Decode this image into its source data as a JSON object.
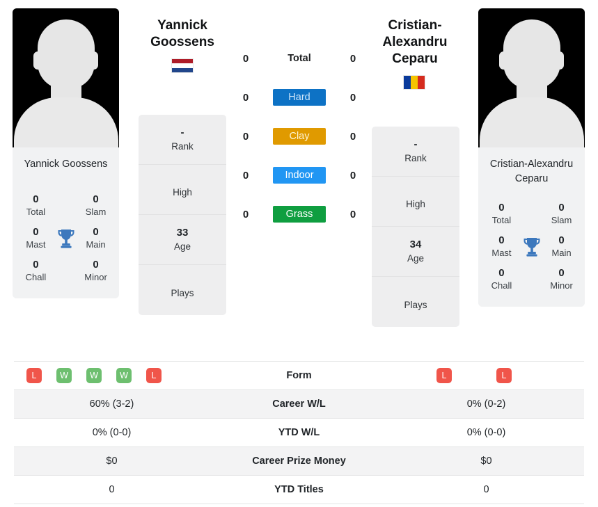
{
  "players": {
    "left": {
      "name": "Yannick Goossens",
      "photo_caption": "Yannick Goossens",
      "flag": "netherlands-flag",
      "avatar": "player-avatar-placeholder",
      "rank_card": [
        {
          "value": "-",
          "label": "Rank"
        },
        {
          "value": "",
          "label": "High"
        },
        {
          "value": "33",
          "label": "Age"
        },
        {
          "value": "",
          "label": "Plays"
        }
      ],
      "titles": {
        "total": "0",
        "slam": "0",
        "mast": "0",
        "main": "0",
        "chall": "0",
        "minor": "0"
      },
      "surface_counts": {
        "total": "0",
        "hard": "0",
        "clay": "0",
        "indoor": "0",
        "grass": "0"
      },
      "form": [
        "L",
        "W",
        "W",
        "W",
        "L"
      ]
    },
    "right": {
      "name": "Cristian-Alexandru Ceparu",
      "photo_caption": "Cristian-Alexandru Ceparu",
      "flag": "romania-flag",
      "avatar": "player-avatar-placeholder",
      "rank_card": [
        {
          "value": "-",
          "label": "Rank"
        },
        {
          "value": "",
          "label": "High"
        },
        {
          "value": "34",
          "label": "Age"
        },
        {
          "value": "",
          "label": "Plays"
        }
      ],
      "titles": {
        "total": "0",
        "slam": "0",
        "mast": "0",
        "main": "0",
        "chall": "0",
        "minor": "0"
      },
      "surface_counts": {
        "total": "0",
        "hard": "0",
        "clay": "0",
        "indoor": "0",
        "grass": "0"
      },
      "form": [
        "L",
        "",
        "L",
        "",
        ""
      ]
    }
  },
  "titles_labels": {
    "total": "Total",
    "slam": "Slam",
    "mast": "Mast",
    "main": "Main",
    "chall": "Chall",
    "minor": "Minor",
    "trophy_icon": "trophy-icon"
  },
  "surfaces": [
    {
      "key": "total",
      "label": "Total",
      "style": "plain"
    },
    {
      "key": "hard",
      "label": "Hard",
      "style": "chip",
      "bg": "#0d72c5",
      "fg": "#cfe6fa"
    },
    {
      "key": "clay",
      "label": "Clay",
      "style": "chip",
      "bg": "#e09a00",
      "fg": "#fdf3d2"
    },
    {
      "key": "indoor",
      "label": "Indoor",
      "style": "chip",
      "bg": "#2196f3",
      "fg": "#ffffff"
    },
    {
      "key": "grass",
      "label": "Grass",
      "style": "chip",
      "bg": "#0f9e40",
      "fg": "#ffffff"
    }
  ],
  "stats_rows": [
    {
      "label": "Form",
      "left": "",
      "right": "",
      "type": "form"
    },
    {
      "label": "Career W/L",
      "left": "60% (3-2)",
      "right": "0% (0-2)",
      "type": "text"
    },
    {
      "label": "YTD W/L",
      "left": "0% (0-0)",
      "right": "0% (0-0)",
      "type": "text"
    },
    {
      "label": "Career Prize Money",
      "left": "$0",
      "right": "$0",
      "type": "text"
    },
    {
      "label": "YTD Titles",
      "left": "0",
      "right": "0",
      "type": "text"
    }
  ],
  "colors": {
    "win_badge": "#6dbf6f",
    "loss_badge": "#f0554a",
    "trophy": "#3c78bd",
    "card_bg": "#f1f2f3",
    "row_alt": "#f3f3f4"
  },
  "flags": {
    "netherlands": [
      "#ae1c28",
      "#ffffff",
      "#21468b"
    ],
    "romania": [
      "#0a3a9b",
      "#f5c400",
      "#d52b1e"
    ]
  }
}
